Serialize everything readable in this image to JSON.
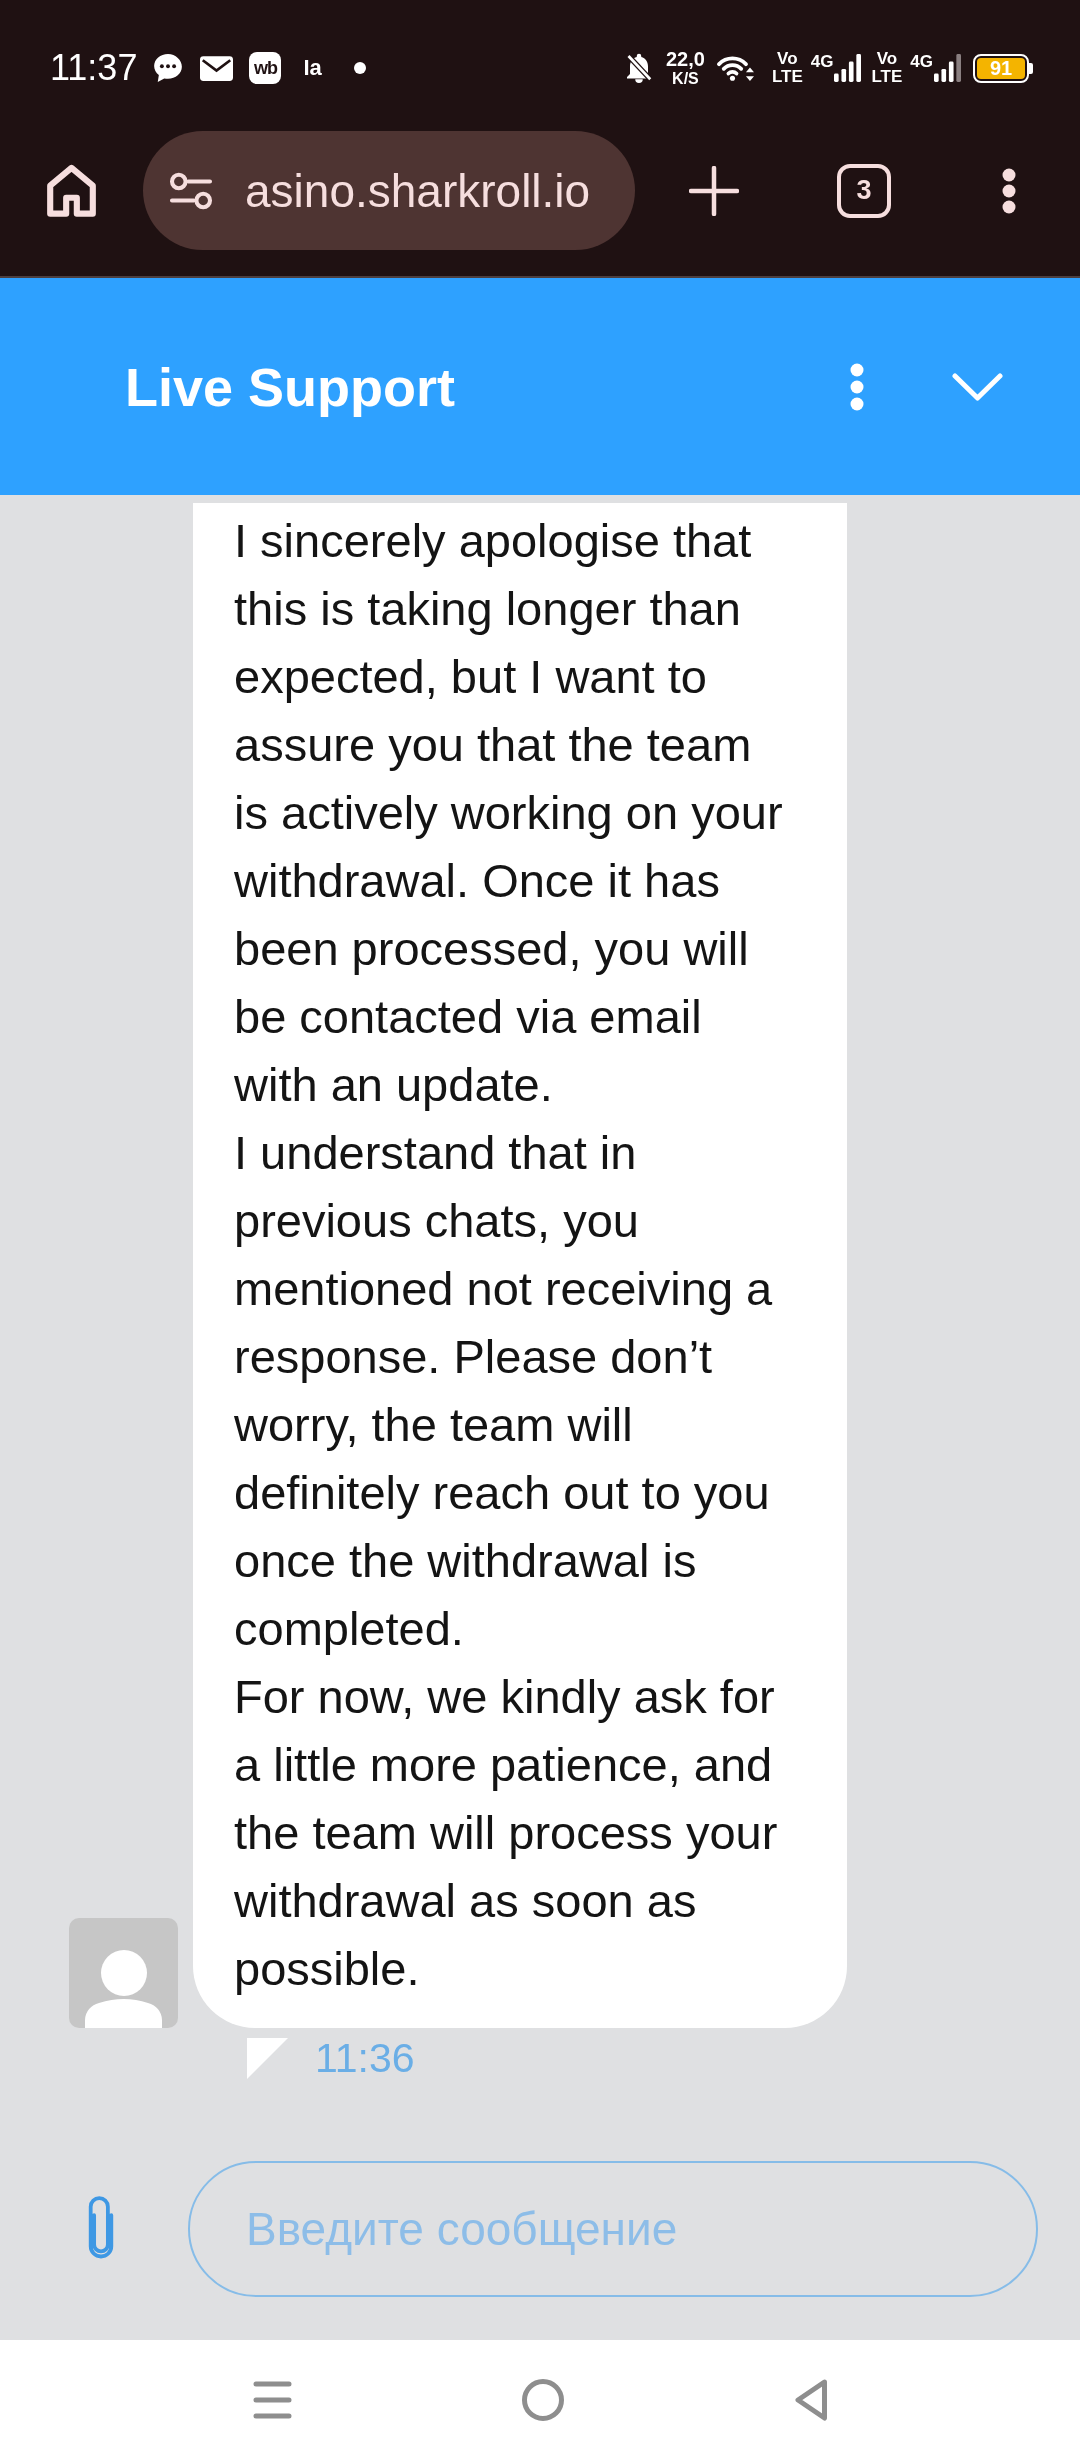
{
  "status_bar": {
    "time": "11:37",
    "app_badge": "wb",
    "notification_text": "Ia",
    "network_speed": "22,0",
    "network_speed_unit": "K/S",
    "sims": [
      {
        "volte": "Vo",
        "volte_sub": "LTE",
        "network": "4G"
      },
      {
        "volte": "Vo",
        "volte_sub": "LTE",
        "network": "4G"
      }
    ],
    "battery": "91"
  },
  "browser": {
    "url": "asino.sharkroll.io",
    "tab_count": "3"
  },
  "chat_header": {
    "title": "Live Support"
  },
  "messages": [
    {
      "paragraphs": [
        "I sincerely apologise that this is taking longer than expected, but I want to assure you that the team is actively working on your withdrawal. Once it has been processed, you will be contacted via email with an update.",
        "I understand that in previous chats, you mentioned not receiving a response. Please don’t worry, the team will definitely reach out to you once the withdrawal is completed.",
        "For now, we kindly ask for a little more patience, and the team will process your withdrawal as soon as possible."
      ],
      "time": "11:36"
    }
  ],
  "composer": {
    "placeholder": "Введите сообщение"
  }
}
